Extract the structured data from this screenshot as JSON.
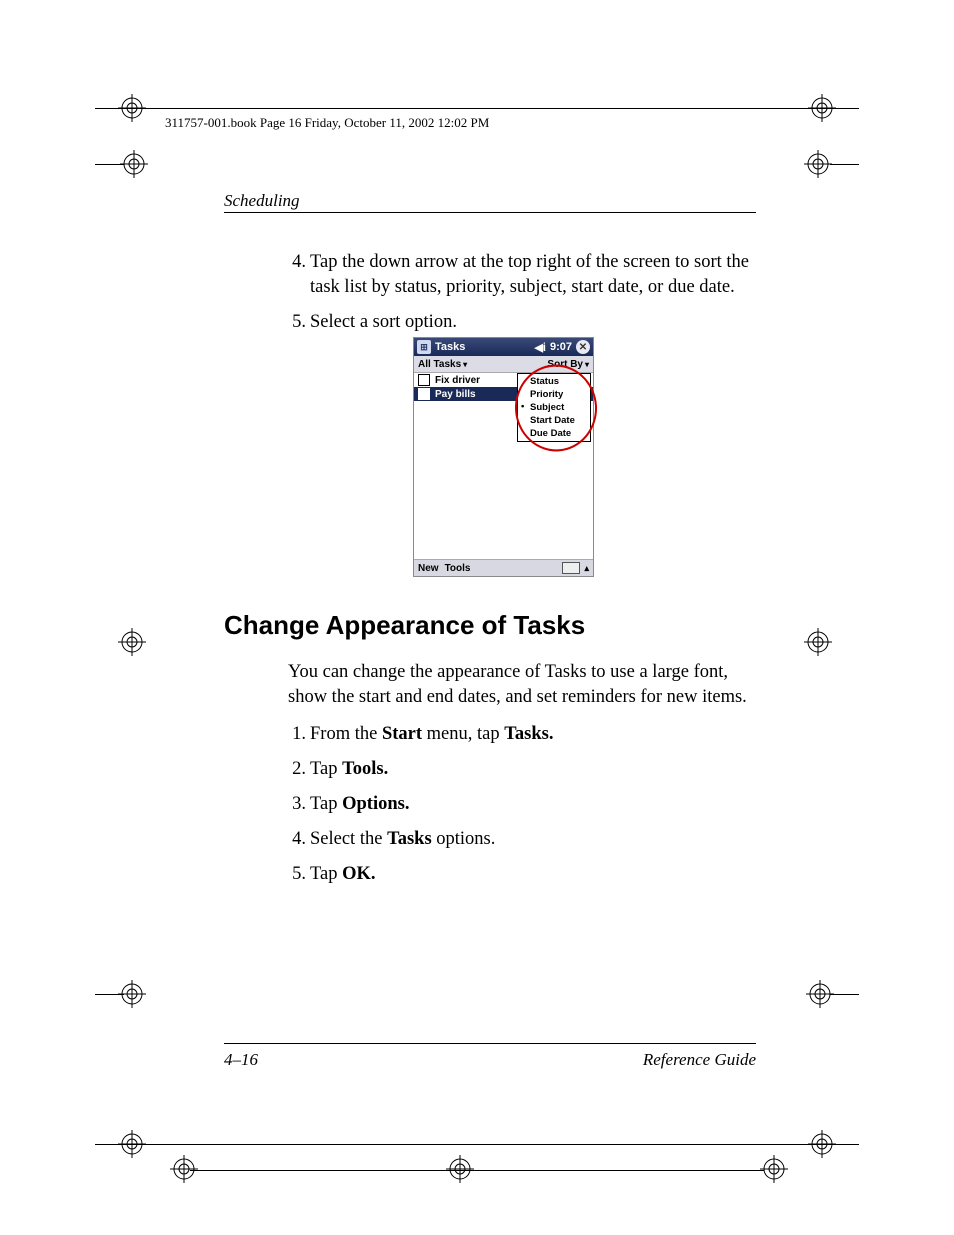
{
  "book_info": "311757-001.book  Page 16  Friday, October 11, 2002  12:02 PM",
  "section_header": "Scheduling",
  "list1": {
    "items": [
      {
        "n": "4.",
        "text": "Tap the down arrow at the top right of the screen to sort the task list by status, priority, subject, start date, or due date."
      },
      {
        "n": "5.",
        "text": "Select a sort option."
      }
    ]
  },
  "heading2": "Change Appearance of Tasks",
  "para2": "You can change the appearance of Tasks to use a large font, show the start and end dates, and set reminders for new items.",
  "list2": {
    "items": [
      {
        "n": "1.",
        "pre": "From the ",
        "b1": "Start",
        "mid": " menu, tap ",
        "b2": "Tasks.",
        "post": ""
      },
      {
        "n": "2.",
        "pre": "Tap ",
        "b1": "Tools.",
        "mid": "",
        "b2": "",
        "post": ""
      },
      {
        "n": "3.",
        "pre": "Tap ",
        "b1": "Options.",
        "mid": "",
        "b2": "",
        "post": ""
      },
      {
        "n": "4.",
        "pre": "Select the ",
        "b1": "Tasks",
        "mid": " options.",
        "b2": "",
        "post": ""
      },
      {
        "n": "5.",
        "pre": "Tap ",
        "b1": "OK.",
        "mid": "",
        "b2": "",
        "post": ""
      }
    ]
  },
  "page_number": "4–16",
  "doc_title": "Reference Guide",
  "figure": {
    "title": "Tasks",
    "time": "9:07",
    "filter": "All Tasks",
    "sort_label": "Sort By",
    "tasks": [
      {
        "label": "Fix driver",
        "selected": false
      },
      {
        "label": "Pay bills",
        "selected": true
      }
    ],
    "sort_menu": [
      "Status",
      "Priority",
      "Subject",
      "Start Date",
      "Due Date"
    ],
    "sort_selected": "Subject",
    "footer_new": "New",
    "footer_tools": "Tools"
  }
}
